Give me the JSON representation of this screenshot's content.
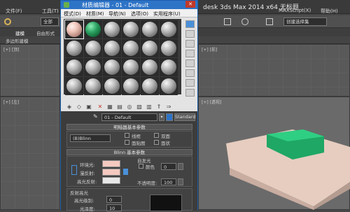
{
  "app": {
    "title": "desk 3ds Max  2014 x64    无标题",
    "menu": [
      "文件(F)",
      "工具(T)",
      "MAXScript(X)",
      "帮助(H)"
    ],
    "ribbon_tabs": [
      "建模",
      "自由形式"
    ],
    "ribbon_sub": "多边形建模",
    "selection_label": "全部",
    "named_selection": "创建选择集"
  },
  "viewports": {
    "top_left": "[+] [顶]",
    "top_right": "[+] [前]",
    "bottom_left": "[+] [左]",
    "bottom_right": "[+] [透视]"
  },
  "material_editor": {
    "title": "材质编辑器 - 01 - Default",
    "menu": [
      "模式(D)",
      "材质(M)",
      "导航(N)",
      "选项(O)",
      "实用程序(U)"
    ],
    "close_label": "✕",
    "material_name": "01 - Default",
    "material_type": "Standard",
    "shader_rollout": "明暗器基本参数",
    "shader_type": "(B)Blinn",
    "shader_options": [
      "线框",
      "双面",
      "面贴图",
      "面状"
    ],
    "blinn_rollout": "Blinn 基本参数",
    "ambient_label": "环境光:",
    "diffuse_label": "漫反射:",
    "specular_label": "高光反射:",
    "self_illum_group": "自发光",
    "color_label": "颜色",
    "self_illum_value": "0",
    "opacity_label": "不透明度:",
    "opacity_value": "100",
    "highlights_group": "反射高光",
    "spec_level_label": "高光级别:",
    "spec_level_value": "0",
    "gloss_label": "光泽度:",
    "gloss_value": "10",
    "ambient_color": "#f4c9c0",
    "diffuse_color": "#f4c9c0",
    "specular_color": "#e8e8e8"
  }
}
